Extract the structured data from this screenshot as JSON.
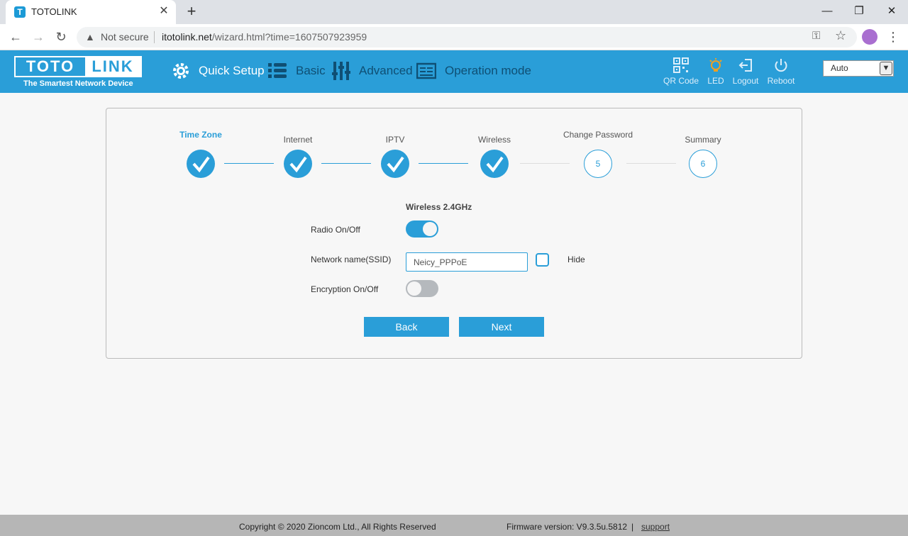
{
  "browser": {
    "tab_title": "TOTOLINK",
    "tab_favicon_letter": "T",
    "security_label": "Not secure",
    "url_host": "itotolink.net",
    "url_path": "/wizard.html?time=1607507923959"
  },
  "header": {
    "logo_left": "TOTO",
    "logo_right": "LINK",
    "tagline": "The Smartest Network Device",
    "nav": [
      {
        "label": "Quick Setup",
        "icon": "gear-icon",
        "active": true
      },
      {
        "label": "Basic",
        "icon": "list-icon",
        "active": false
      },
      {
        "label": "Advanced",
        "icon": "sliders-icon",
        "active": false
      },
      {
        "label": "Operation mode",
        "icon": "console-icon",
        "active": false
      }
    ],
    "utilities": [
      {
        "label": "QR Code",
        "icon": "qr-code-icon"
      },
      {
        "label": "LED",
        "icon": "led-bulb-icon"
      },
      {
        "label": "Logout",
        "icon": "logout-icon"
      },
      {
        "label": "Reboot",
        "icon": "power-icon"
      }
    ],
    "language": "Auto"
  },
  "wizard": {
    "steps": [
      {
        "label": "Time Zone",
        "status": "current-done"
      },
      {
        "label": "Internet",
        "status": "done"
      },
      {
        "label": "IPTV",
        "status": "done"
      },
      {
        "label": "Wireless",
        "status": "done"
      },
      {
        "label": "Change Password",
        "status": "todo",
        "number": "5"
      },
      {
        "label": "Summary",
        "status": "todo",
        "number": "6"
      }
    ],
    "section_title": "Wireless 2.4GHz",
    "radio_label": "Radio On/Off",
    "radio_on": true,
    "ssid_label": "Network name(SSID)",
    "ssid_value": "Neicy_PPPoE",
    "hide_label": "Hide",
    "hide_checked": false,
    "encryption_label": "Encryption On/Off",
    "encryption_on": false,
    "back_label": "Back",
    "next_label": "Next"
  },
  "footer": {
    "copyright": "Copyright © 2020 Zioncom Ltd., All Rights Reserved",
    "firmware": "Firmware version: V9.3.5u.5812",
    "separator": "|",
    "support": "support"
  },
  "colors": {
    "accent": "#2a9ed8",
    "footer_bg": "#b6b6b6",
    "page_bg": "#f7f7f7"
  }
}
